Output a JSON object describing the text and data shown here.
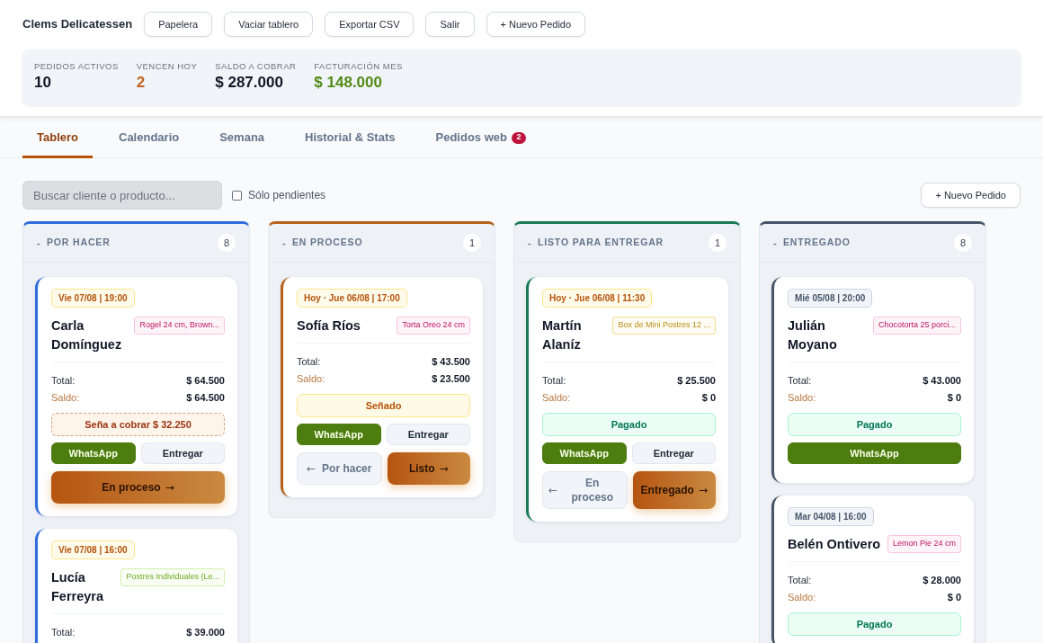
{
  "header": {
    "title": "Clems Delicatessen",
    "buttons": [
      "Papelera",
      "Vaciar tablero",
      "Exportar CSV",
      "Salir",
      "+ Nuevo Pedido"
    ]
  },
  "stats": [
    {
      "label": "PEDIDOS ACTIVOS",
      "value": "10",
      "color": "#111827"
    },
    {
      "label": "VENCEN HOY",
      "value": "2",
      "color": "#c2621d"
    },
    {
      "label": "SALDO A COBRAR",
      "value": "$ 287.000",
      "color": "#111827"
    },
    {
      "label": "FACTURACIÓN MES",
      "value": "$ 148.000",
      "color": "#528a17"
    }
  ],
  "tabs": [
    {
      "label": "Tablero",
      "selected": true
    },
    {
      "label": "Calendario",
      "selected": false
    },
    {
      "label": "Semana",
      "selected": false
    },
    {
      "label": "Historial & Stats",
      "selected": false
    },
    {
      "label": "Pedidos web",
      "selected": false,
      "badge": "2"
    }
  ],
  "toolbar": {
    "search": {
      "placeholder": "Buscar cliente o producto..."
    },
    "filter": {
      "label": "Sólo pendientes",
      "checked": false
    },
    "button": "+ Nuevo Pedido"
  },
  "columns": [
    {
      "toggle": "-",
      "title": "POR HACER",
      "count": "8",
      "color": "#2f6bd9",
      "cards": [
        {
          "date": "Vie 07/08 | 19:00",
          "past": false,
          "name": "Carla Domínguez",
          "tag": {
            "text": "Rogel 24 cm, Brown...",
            "color": "#f9c4dd"
          },
          "totals": [
            {
              "kind": "total",
              "label": "Total:",
              "value": "$ 64.500"
            },
            {
              "kind": "balance",
              "label": "Saldo:",
              "value": "$ 64.500"
            }
          ],
          "payment": {
            "kind": "deposit_due",
            "text": "Seña a cobrar $ 32.250"
          },
          "actions": [
            {
              "kind": "whatsapp",
              "label": "WhatsApp"
            },
            {
              "kind": "deliver",
              "label": "Entregar"
            }
          ],
          "nav": [
            {
              "kind": "forward",
              "label": "En proceso",
              "arrow": "→"
            }
          ]
        },
        {
          "date": "Vie 07/08 | 16:00",
          "past": false,
          "name": "Lucía Ferreyra",
          "tag": {
            "text": "Postres Individuales (Le...",
            "color": "#d3eeae"
          },
          "totals": [
            {
              "kind": "total",
              "label": "Total:",
              "value": "$ 39.000"
            }
          ]
        }
      ]
    },
    {
      "toggle": "-",
      "title": "EN PROCESO",
      "count": "1",
      "color": "#b5621c",
      "cards": [
        {
          "date": "Hoy · Jue 06/08 | 17:00",
          "past": false,
          "name": "Sofía Ríos",
          "tag": {
            "text": "Torta Oreo 24 cm",
            "color": "#f9c4dd"
          },
          "totals": [
            {
              "kind": "total",
              "label": "Total:",
              "value": "$ 43.500"
            },
            {
              "kind": "balance",
              "label": "Saldo:",
              "value": "$ 23.500"
            }
          ],
          "payment": {
            "kind": "deposit_paid",
            "text": "Señado"
          },
          "actions": [
            {
              "kind": "whatsapp",
              "label": "WhatsApp"
            },
            {
              "kind": "deliver",
              "label": "Entregar"
            }
          ],
          "nav": [
            {
              "kind": "back",
              "label": "Por hacer",
              "arrow": "←"
            },
            {
              "kind": "forward",
              "label": "Listo",
              "arrow": "→"
            }
          ]
        }
      ]
    },
    {
      "toggle": "-",
      "title": "LISTO PARA ENTREGAR",
      "count": "1",
      "color": "#1b7a56",
      "cards": [
        {
          "date": "Hoy · Jue 06/08 | 11:30",
          "past": false,
          "name": "Martín Alaníz",
          "tag": {
            "text": "Box de Mini Postres 12 ...",
            "color": "#f5dc8e"
          },
          "totals": [
            {
              "kind": "total",
              "label": "Total:",
              "value": "$ 25.500"
            },
            {
              "kind": "balance",
              "label": "Saldo:",
              "value": "$ 0"
            }
          ],
          "payment": {
            "kind": "paid",
            "text": "Pagado"
          },
          "actions": [
            {
              "kind": "whatsapp",
              "label": "WhatsApp"
            },
            {
              "kind": "deliver",
              "label": "Entregar"
            }
          ],
          "nav": [
            {
              "kind": "back",
              "label": "En proceso",
              "arrow": "←"
            },
            {
              "kind": "forward",
              "label": "Entregado",
              "arrow": "→"
            }
          ]
        }
      ]
    },
    {
      "toggle": "-",
      "title": "ENTREGADO",
      "count": "8",
      "color": "#475569",
      "cards": [
        {
          "date": "Mié 05/08 | 20:00",
          "past": true,
          "name": "Julián Moyano",
          "tag": {
            "text": "Chocotorta 25 porci...",
            "color": "#f9c4dd"
          },
          "totals": [
            {
              "kind": "total",
              "label": "Total:",
              "value": "$ 43.000"
            },
            {
              "kind": "balance",
              "label": "Saldo:",
              "value": "$ 0"
            }
          ],
          "payment": {
            "kind": "paid",
            "text": "Pagado"
          },
          "actions": [
            {
              "kind": "whatsapp",
              "label": "WhatsApp"
            }
          ]
        },
        {
          "date": "Mar 04/08 | 16:00",
          "past": true,
          "name": "Belén Ontivero",
          "tag": {
            "text": "Lemon Pie 24 cm",
            "color": "#f9c4dd"
          },
          "totals": [
            {
              "kind": "total",
              "label": "Total:",
              "value": "$ 28.000"
            },
            {
              "kind": "balance",
              "label": "Saldo:",
              "value": "$ 0"
            }
          ],
          "payment": {
            "kind": "paid",
            "text": "Pagado"
          }
        }
      ]
    }
  ]
}
